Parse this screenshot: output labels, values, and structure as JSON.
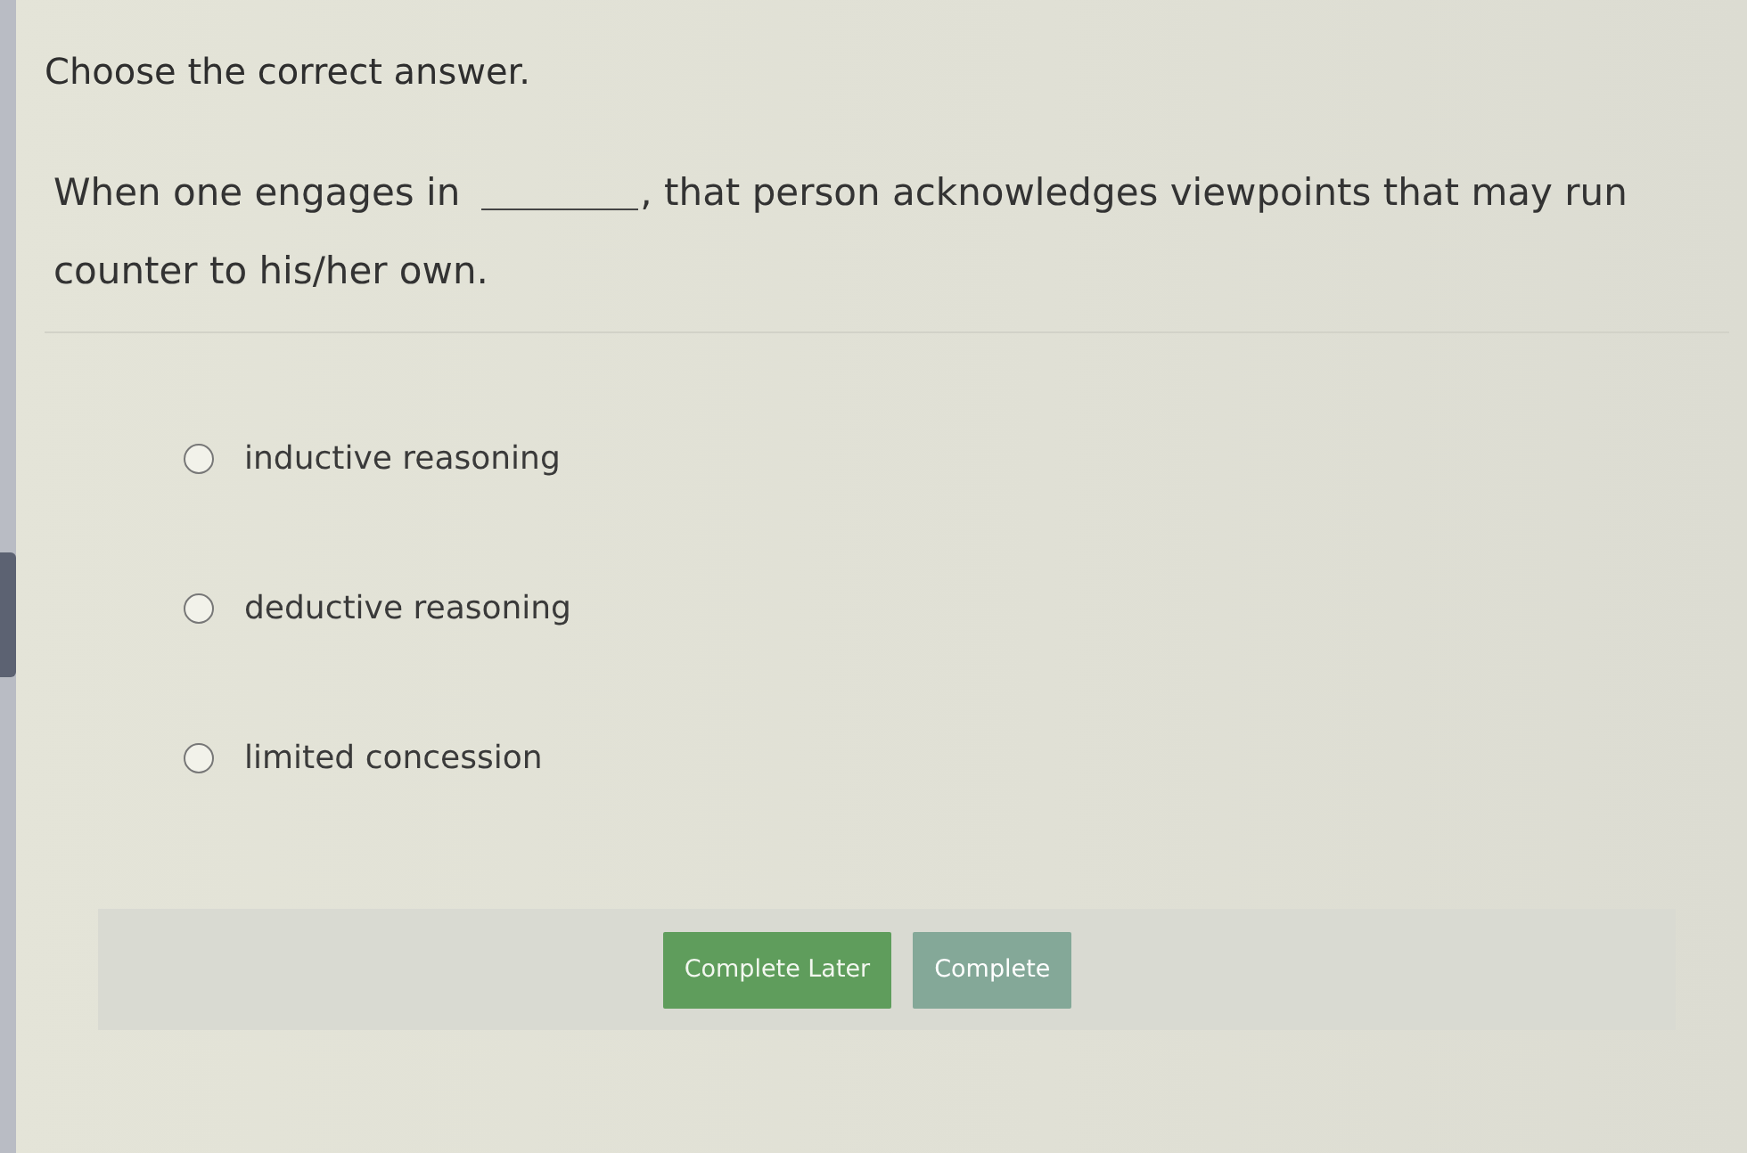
{
  "instruction": "Choose the correct answer.",
  "question": {
    "text_before": "When one engages in",
    "text_after": ", that person acknowledges viewpoints that may run",
    "text_continued": "counter to his/her own."
  },
  "options": [
    {
      "label": "inductive reasoning",
      "selected": false
    },
    {
      "label": "deductive reasoning",
      "selected": false
    },
    {
      "label": "limited concession",
      "selected": false
    }
  ],
  "buttons": [
    {
      "label": "Complete Later",
      "disabled": false
    },
    {
      "label": "Complete",
      "disabled": true
    }
  ]
}
